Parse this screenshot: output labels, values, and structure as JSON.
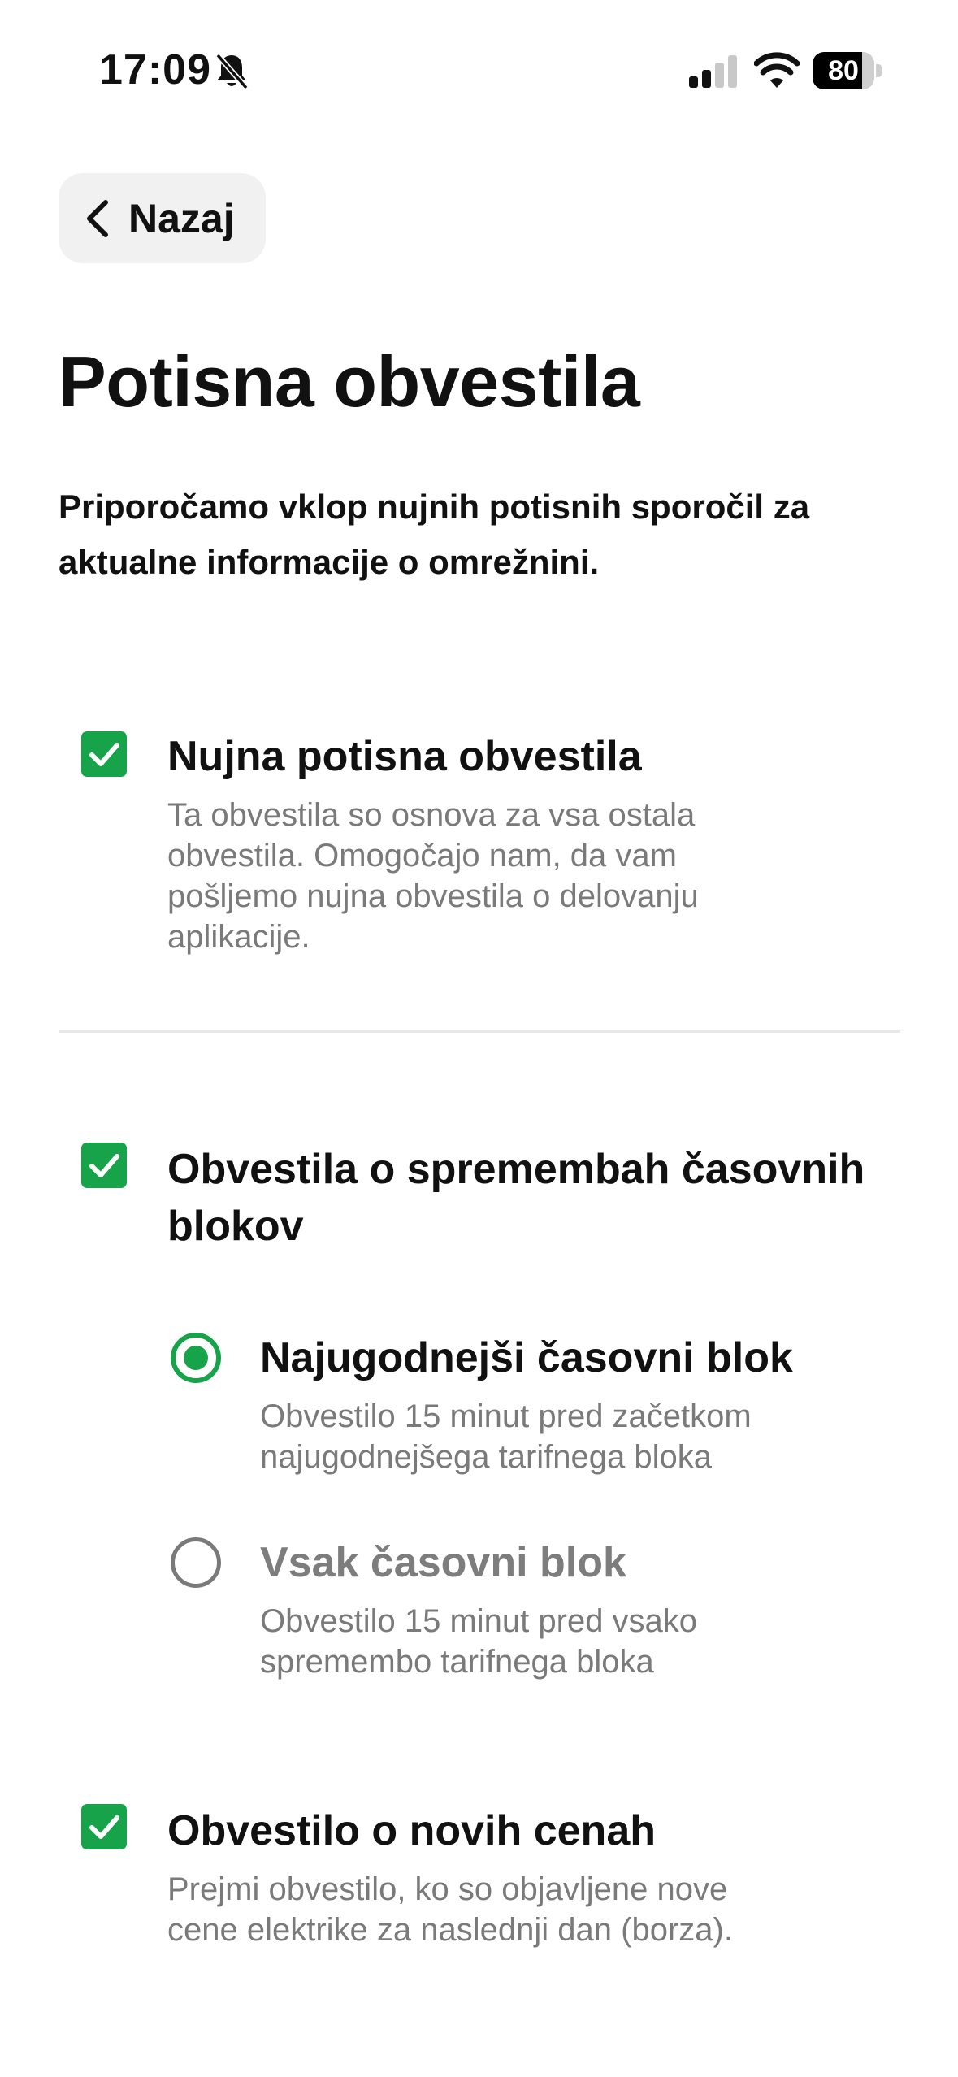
{
  "status_bar": {
    "time": "17:09",
    "battery": "80",
    "battery_level": 0.8
  },
  "nav": {
    "back_label": "Nazaj"
  },
  "page": {
    "title": "Potisna obvestila",
    "intro": "Priporočamo vklop nujnih potisnih sporočil za aktualne informacije o omrežnini."
  },
  "options": {
    "urgent": {
      "checked": true,
      "title": "Nujna potisna obvestila",
      "desc_lines": [
        "Ta obvestila so osnova za vsa ostala",
        "obvestila. Omogočajo nam, da vam",
        "pošljemo nujna obvestila o delovanju",
        "aplikacije."
      ]
    },
    "blocks": {
      "checked": true,
      "title_lines": [
        "Obvestila o spremembah časovnih",
        "blokov"
      ],
      "radios": [
        {
          "selected": true,
          "title": "Najugodnejši časovni blok",
          "desc_lines": [
            "Obvestilo 15 minut pred začetkom",
            "najugodnejšega tarifnega bloka"
          ]
        },
        {
          "selected": false,
          "title": "Vsak časovni blok",
          "desc_lines": [
            "Obvestilo 15 minut pred vsako",
            "spremembo tarifnega bloka"
          ]
        }
      ]
    },
    "prices": {
      "checked": true,
      "title": "Obvestilo o novih cenah",
      "desc_lines": [
        "Prejmi obvestilo, ko so objavljene nove",
        "cene elektrike za naslednji dan (borza)."
      ]
    }
  },
  "colors": {
    "accent": "#17a34a",
    "muted": "#7a7a7a",
    "button_bg": "#f1f1f1"
  },
  "icons": [
    "bell-slash-icon",
    "cellular-signal-icon",
    "wifi-icon",
    "battery-icon",
    "chevron-left-icon",
    "checkmark-icon"
  ]
}
